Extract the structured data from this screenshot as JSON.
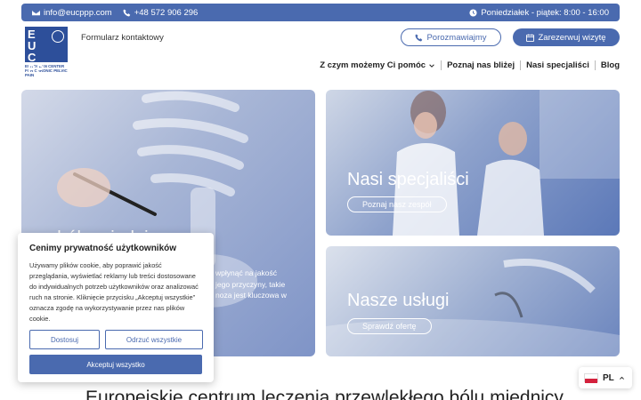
{
  "topbar": {
    "email": "info@eucppp.com",
    "phone": "+48 572 906 296",
    "hours": "Poniedziałek - piątek: 8:00 - 16:00"
  },
  "header": {
    "logo_letters": "EUCPP",
    "logo_caption": "EUROPEAN CENTER FOR CHRONIC PELVIC PAIN",
    "contact_form": "Formularz kontaktowy",
    "talk_button": "Porozmawiajmy",
    "book_button": "Zarezerwuj wizytę"
  },
  "nav": {
    "items": [
      {
        "label": "Z czym możemy Ci pomóc",
        "has_dropdown": true
      },
      {
        "label": "Poznaj nas bliżej",
        "has_dropdown": false
      },
      {
        "label": "Nasi specjaliści",
        "has_dropdown": false
      },
      {
        "label": "Blog",
        "has_dropdown": false
      }
    ]
  },
  "hero": {
    "big_card": {
      "title_partial": "...y bólu miednicy",
      "text_lines": [
        "wpłynąć na jakość",
        "jego przyczyny, takie",
        "noza jest kluczowa w"
      ]
    },
    "specialists_card": {
      "title": "Nasi specjaliści",
      "button": "Poznaj nasz zespół"
    },
    "services_card": {
      "title": "Nasze usługi",
      "button": "Sprawdź ofertę"
    }
  },
  "cookie": {
    "title": "Cenimy prywatność użytkowników",
    "text": "Używamy plików cookie, aby poprawić jakość przeglądania, wyświetlać reklamy lub treści dostosowane do indywidualnych potrzeb użytkowników oraz analizować ruch na stronie. Kliknięcie przycisku „Akceptuj wszystkie” oznacza zgodę na wykorzystywanie przez nas plików cookie.",
    "customize": "Dostosuj",
    "reject": "Odrzuć wszystkie",
    "accept": "Akceptuj wszystko"
  },
  "bottom_heading": "Europejskie centrum leczenia przewlekłego bólu miednicy",
  "language": {
    "code": "PL"
  },
  "colors": {
    "brand": "#4a6aaf",
    "logo": "#2d4f9a",
    "flag_red": "#d4213d"
  }
}
